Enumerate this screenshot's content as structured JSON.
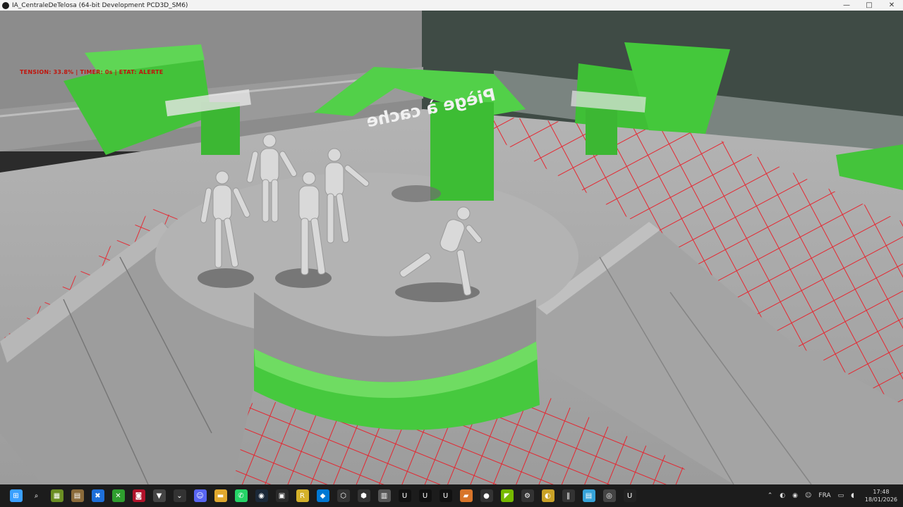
{
  "window": {
    "title": "IA_CentraleDeTelosa (64-bit Development PCD3D_SM6)",
    "minimize": "—",
    "maximize": "□",
    "close": "✕"
  },
  "hud": {
    "status_text": "TENSION: 33.8% | TIMER: 0s | ETAT: ALERTE"
  },
  "scene": {
    "sign_text": "Piège à cache",
    "colors": {
      "floor": "#a9a9a9",
      "wall": "#8e8e8e",
      "dark_wall": "#3e4a44",
      "green": "#46c93e",
      "red_grid": "#e8202a",
      "mannequin": "#d9d9d9"
    }
  },
  "taskbar": {
    "icons": [
      {
        "name": "windows-start-icon",
        "glyph": "⊞",
        "color": "#3aa0ff"
      },
      {
        "name": "search-icon",
        "glyph": "⌕",
        "color": "#1c1c1c"
      },
      {
        "name": "minecraft-icon",
        "glyph": "▦",
        "color": "#6b8e23"
      },
      {
        "name": "file-explorer-alt-icon",
        "glyph": "▤",
        "color": "#8b6b3a"
      },
      {
        "name": "app-blue-icon",
        "glyph": "✖",
        "color": "#1e6fd9"
      },
      {
        "name": "xbox-icon",
        "glyph": "✕",
        "color": "#2e9e2e"
      },
      {
        "name": "app-red-icon",
        "glyph": "◙",
        "color": "#b1122a"
      },
      {
        "name": "app-v-icon",
        "glyph": "▼",
        "color": "#444"
      },
      {
        "name": "app-chevron-icon",
        "glyph": "⌄",
        "color": "#333"
      },
      {
        "name": "discord-icon",
        "glyph": "☺",
        "color": "#5865f2"
      },
      {
        "name": "folder-icon",
        "glyph": "▬",
        "color": "#e0a82e"
      },
      {
        "name": "whatsapp-icon",
        "glyph": "✆",
        "color": "#25d366"
      },
      {
        "name": "steam-icon",
        "glyph": "◉",
        "color": "#1b2838"
      },
      {
        "name": "terminal-icon",
        "glyph": "▣",
        "color": "#2a2a2a"
      },
      {
        "name": "app-r-icon",
        "glyph": "R",
        "color": "#d4b12a"
      },
      {
        "name": "vscode-icon",
        "glyph": "◆",
        "color": "#0078d4"
      },
      {
        "name": "app-hex-icon",
        "glyph": "⬡",
        "color": "#333"
      },
      {
        "name": "app-cube-icon",
        "glyph": "⬢",
        "color": "#333"
      },
      {
        "name": "app-grid-icon",
        "glyph": "▥",
        "color": "#555"
      },
      {
        "name": "unreal-icon",
        "glyph": "U",
        "color": "#111"
      },
      {
        "name": "unreal-icon-2",
        "glyph": "U",
        "color": "#111"
      },
      {
        "name": "unreal-icon-3",
        "glyph": "U",
        "color": "#111"
      },
      {
        "name": "app-orange-icon",
        "glyph": "▰",
        "color": "#d8752a"
      },
      {
        "name": "app-ball-icon",
        "glyph": "●",
        "color": "#333"
      },
      {
        "name": "nvidia-icon",
        "glyph": "◤",
        "color": "#76b900"
      },
      {
        "name": "settings-icon",
        "glyph": "⚙",
        "color": "#333"
      },
      {
        "name": "app-yellow-icon",
        "glyph": "◐",
        "color": "#c9a227"
      },
      {
        "name": "app-bar-icon",
        "glyph": "‖",
        "color": "#333"
      },
      {
        "name": "notepad-icon",
        "glyph": "▤",
        "color": "#36a3d9"
      },
      {
        "name": "app-record-icon",
        "glyph": "◎",
        "color": "#444"
      },
      {
        "name": "unreal-active-icon",
        "glyph": "U",
        "color": "#222"
      }
    ],
    "tray": {
      "chevron": "⌃",
      "lang": "FRA",
      "time": "17:48",
      "date": "18/01/2026"
    }
  }
}
